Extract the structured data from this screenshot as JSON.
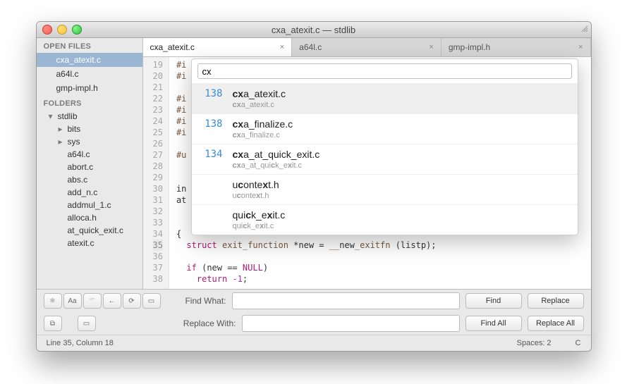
{
  "window_title": "cxa_atexit.c — stdlib",
  "sidebar": {
    "open_files_label": "OPEN FILES",
    "open_files": [
      "cxa_atexit.c",
      "a64l.c",
      "gmp-impl.h"
    ],
    "folders_label": "FOLDERS",
    "root": "stdlib",
    "sub_dirs": [
      "bits",
      "sys"
    ],
    "files": [
      "a64l.c",
      "abort.c",
      "abs.c",
      "add_n.c",
      "addmul_1.c",
      "alloca.h",
      "at_quick_exit.c",
      "atexit.c"
    ]
  },
  "tabs": [
    {
      "label": "cxa_atexit.c",
      "active": true
    },
    {
      "label": "a64l.c",
      "active": false
    },
    {
      "label": "gmp-impl.h",
      "active": false
    }
  ],
  "gutter": {
    "start": 19,
    "end": 38,
    "highlight": 35
  },
  "code_lines": [
    "#i",
    "#i",
    "",
    "#i",
    "#i",
    "#i",
    "#i",
    "",
    "#u",
    "",
    "",
    "in",
    "at",
    "",
    "",
    "{",
    "  struct exit_function *new = __new_exitfn (listp);",
    "",
    "  if (new == NULL)",
    "    return -1;"
  ],
  "goto": {
    "query": "cx",
    "items": [
      {
        "score": "138",
        "name_html": "<b>cx</b>a_atexit.c",
        "path_html": "<b>cx</b>a_atexit.c",
        "selected": true
      },
      {
        "score": "138",
        "name_html": "<b>cx</b>a_finalize.c",
        "path_html": "<b>cx</b>a_finalize.c",
        "selected": false
      },
      {
        "score": "134",
        "name_html": "<b>cx</b>a_at_quick_exit.c",
        "path_html": "<b>cx</b>a_at_qui<b>c</b>k_e<b>x</b>it.c",
        "selected": false
      },
      {
        "score": "",
        "name_html": "u<b>c</b>onte<b>x</b>t.h",
        "path_html": "u<b>c</b>onte<b>x</b>t.h",
        "selected": false
      },
      {
        "score": "",
        "name_html": "qui<b>c</b>k_e<b>x</b>it.c",
        "path_html": "qui<b>c</b>k_e<b>x</b>it.c",
        "selected": false
      }
    ]
  },
  "find": {
    "label": "Find What:",
    "replace_label": "Replace With:",
    "find_btn": "Find",
    "replace_btn": "Replace",
    "findall_btn": "Find All",
    "replaceall_btn": "Replace All"
  },
  "status": {
    "left": "Line 35, Column 18",
    "spaces": "Spaces: 2",
    "syntax": "C"
  }
}
